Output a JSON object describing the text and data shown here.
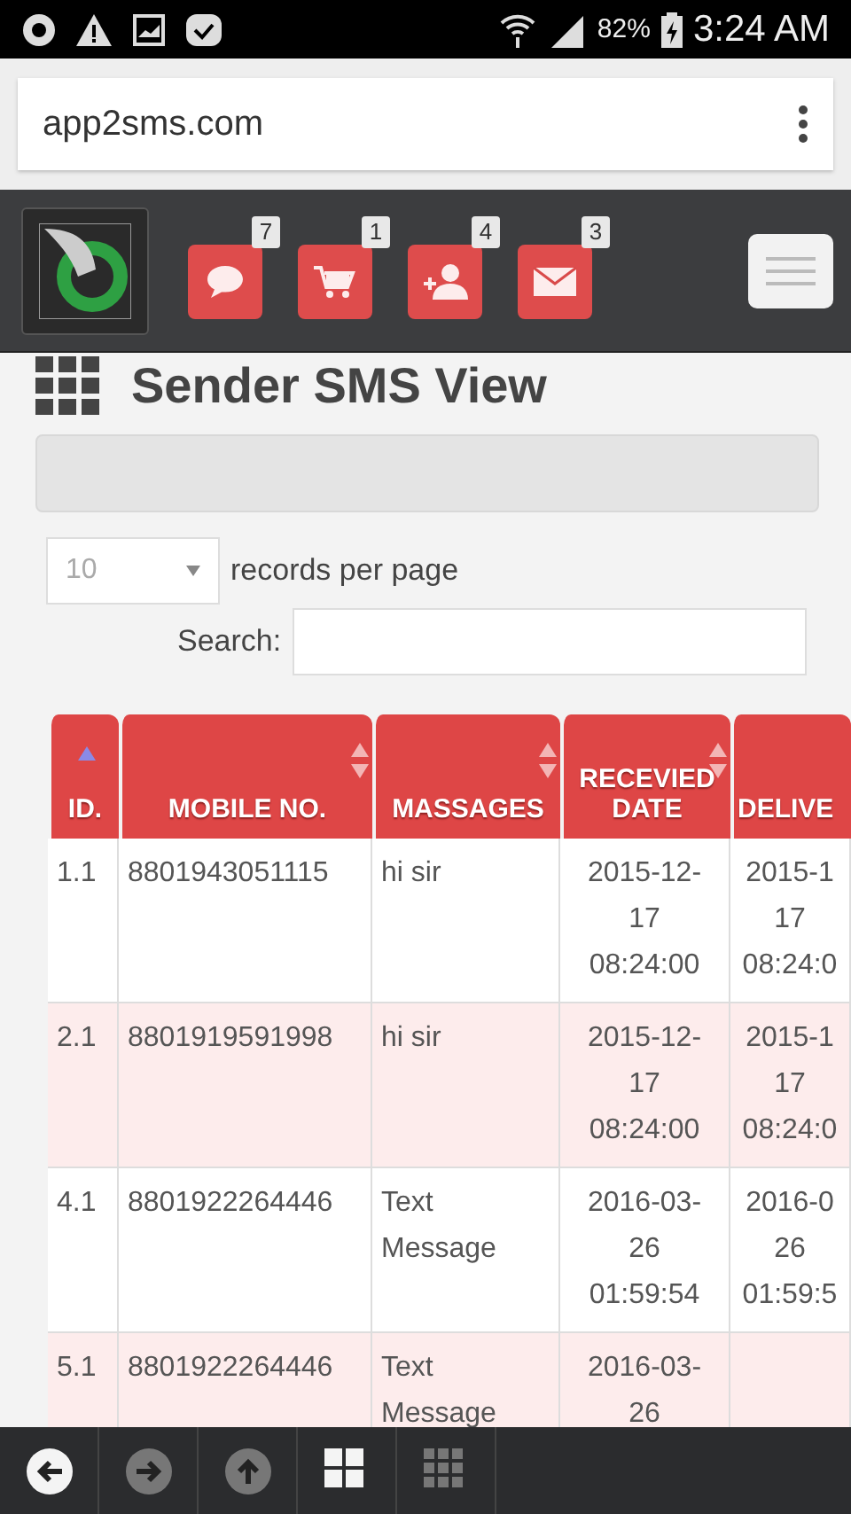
{
  "status_bar": {
    "battery": "82%",
    "time": "3:24 AM"
  },
  "address_bar": {
    "url": "app2sms.com"
  },
  "nav": {
    "badges": [
      {
        "kind": "chat",
        "count": "7"
      },
      {
        "kind": "cart",
        "count": "1"
      },
      {
        "kind": "add-user",
        "count": "4"
      },
      {
        "kind": "mail",
        "count": "3"
      }
    ]
  },
  "page": {
    "title": "Sender SMS View",
    "page_size": "10",
    "page_size_label": "records per page",
    "search_label": "Search:"
  },
  "table": {
    "columns": [
      {
        "label": "ID.",
        "sorted": true
      },
      {
        "label": "MOBILE NO.",
        "sorted": false
      },
      {
        "label": "MASSAGES",
        "sorted": false
      },
      {
        "label": "RECEVIED DATE",
        "sorted": false
      },
      {
        "label": "DELIVE"
      }
    ],
    "rows": [
      {
        "cells": [
          "1.1",
          "8801943051115",
          "hi sir",
          "2015-12-\n17\n08:24:00",
          "2015-1\n17\n08:24:0"
        ]
      },
      {
        "cells": [
          "2.1",
          "8801919591998",
          "hi sir",
          "2015-12-\n17\n08:24:00",
          "2015-1\n17\n08:24:0"
        ]
      },
      {
        "cells": [
          "4.1",
          "8801922264446",
          "Text Message",
          "2016-03-\n26\n01:59:54",
          "2016-0\n26\n01:59:5"
        ]
      },
      {
        "cells": [
          "5.1",
          "8801922264446",
          "Text Message",
          "2016-03-\n26"
        ]
      }
    ]
  },
  "toolbar": [
    {
      "kind": "back",
      "disabled": false
    },
    {
      "kind": "forward",
      "disabled": true
    },
    {
      "kind": "up",
      "disabled": true
    },
    {
      "kind": "tiles",
      "selected": true
    },
    {
      "kind": "grid",
      "selected": false
    }
  ]
}
